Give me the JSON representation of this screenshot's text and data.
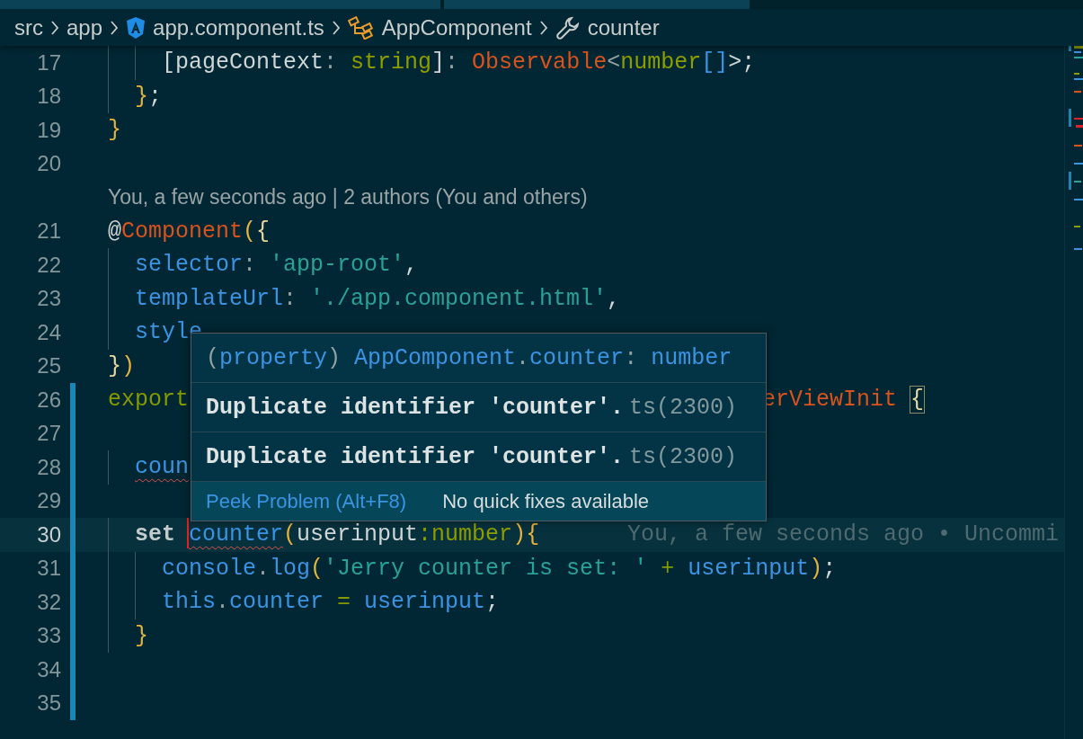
{
  "breadcrumb": [
    {
      "label": "src",
      "kind": "folder"
    },
    {
      "label": "app",
      "kind": "folder"
    },
    {
      "label": "app.component.ts",
      "kind": "file"
    },
    {
      "label": "AppComponent",
      "kind": "class"
    },
    {
      "label": "counter",
      "kind": "member"
    }
  ],
  "lines": [
    {
      "number": "17",
      "current": false,
      "modified": false,
      "tokens": [
        {
          "text": "    [pageContext",
          "kind": "plain"
        },
        {
          "text": ":",
          "kind": "punct"
        },
        {
          "text": " string",
          "kind": "type"
        },
        {
          "text": "]",
          "kind": "plain"
        },
        {
          "text": ": ",
          "kind": "punct"
        },
        {
          "text": "Observable",
          "kind": "class"
        },
        {
          "text": "<",
          "kind": "punct"
        },
        {
          "text": "number",
          "kind": "type"
        },
        {
          "text": "[]",
          "kind": "property"
        },
        {
          "text": ">;",
          "kind": "plain"
        }
      ]
    },
    {
      "number": "18",
      "current": false,
      "modified": false,
      "tokens": [
        {
          "text": "  }",
          "kind": "bracket"
        },
        {
          "text": ";",
          "kind": "plain"
        }
      ]
    },
    {
      "number": "19",
      "current": false,
      "modified": false,
      "tokens": [
        {
          "text": "}",
          "kind": "bracket"
        }
      ]
    },
    {
      "number": "20",
      "current": false,
      "modified": false
    },
    {
      "codelens": "You, a few seconds ago | 2 authors (You and others)"
    },
    {
      "number": "21",
      "current": false,
      "modified": false,
      "tokens": [
        {
          "text": "@",
          "kind": "plain"
        },
        {
          "text": "Component",
          "kind": "class"
        },
        {
          "text": "(",
          "kind": "bracket"
        },
        {
          "text": "{",
          "kind": "brace"
        }
      ]
    },
    {
      "number": "22",
      "current": false,
      "modified": false,
      "tokens": [
        {
          "text": "  selector",
          "kind": "property"
        },
        {
          "text": ": ",
          "kind": "punct"
        },
        {
          "text": "'app-root'",
          "kind": "string"
        },
        {
          "text": ",",
          "kind": "plain"
        }
      ]
    },
    {
      "number": "23",
      "current": false,
      "modified": false,
      "tokens": [
        {
          "text": "  templateUrl",
          "kind": "property"
        },
        {
          "text": ": ",
          "kind": "punct"
        },
        {
          "text": "'./app.component.html'",
          "kind": "string"
        },
        {
          "text": ",",
          "kind": "plain"
        }
      ]
    },
    {
      "number": "24",
      "current": false,
      "modified": false,
      "tokens": [
        {
          "text": "  style",
          "kind": "property"
        }
      ]
    },
    {
      "number": "25",
      "current": false,
      "modified": false,
      "tokens": [
        {
          "text": "}",
          "kind": "brace"
        },
        {
          "text": ")",
          "kind": "bracket"
        }
      ]
    },
    {
      "number": "26",
      "current": false,
      "modified": true,
      "tokens": [
        {
          "text": "export",
          "kind": "keyword"
        }
      ],
      "tail": [
        {
          "text": "erViewInit",
          "kind": "class"
        },
        {
          "text": "{",
          "kind": "match"
        }
      ]
    },
    {
      "number": "27",
      "current": false,
      "modified": true
    },
    {
      "number": "28",
      "current": false,
      "modified": true,
      "tokens": [
        {
          "text": "  coun",
          "kind": "property",
          "error": true
        }
      ]
    },
    {
      "number": "29",
      "current": false,
      "modified": true
    },
    {
      "number": "30",
      "current": true,
      "modified": true,
      "tokens": [
        {
          "text": "  set ",
          "kind": "storage"
        },
        {
          "text": "counter",
          "kind": "property",
          "error": true,
          "caret": true
        },
        {
          "text": "(",
          "kind": "bracket"
        },
        {
          "text": "userinput",
          "kind": "plain"
        },
        {
          "text": ":number",
          "kind": "type"
        },
        {
          "text": ")",
          "kind": "bracket"
        },
        {
          "text": "{",
          "kind": "bracket"
        }
      ],
      "blame": "You, a few seconds ago • Uncommi"
    },
    {
      "number": "31",
      "current": false,
      "modified": true,
      "tokens": [
        {
          "text": "    console",
          "kind": "property"
        },
        {
          "text": ".",
          "kind": "punct"
        },
        {
          "text": "log",
          "kind": "property"
        },
        {
          "text": "(",
          "kind": "bracket"
        },
        {
          "text": "'Jerry counter is set: '",
          "kind": "string"
        },
        {
          "text": " + ",
          "kind": "keyword"
        },
        {
          "text": "userinput",
          "kind": "property"
        },
        {
          "text": ")",
          "kind": "bracket"
        },
        {
          "text": ";",
          "kind": "plain"
        }
      ]
    },
    {
      "number": "32",
      "current": false,
      "modified": true,
      "tokens": [
        {
          "text": "    this",
          "kind": "property"
        },
        {
          "text": ".",
          "kind": "punct"
        },
        {
          "text": "counter",
          "kind": "property"
        },
        {
          "text": " = ",
          "kind": "keyword"
        },
        {
          "text": "userinput",
          "kind": "property"
        },
        {
          "text": ";",
          "kind": "plain"
        }
      ]
    },
    {
      "number": "33",
      "current": false,
      "modified": true,
      "tokens": [
        {
          "text": "  }",
          "kind": "bracket"
        }
      ]
    },
    {
      "number": "34",
      "current": false,
      "modified": true
    },
    {
      "number": "35",
      "current": false,
      "modified": true
    }
  ],
  "hover": {
    "signature": [
      {
        "text": "(",
        "kind": "punct"
      },
      {
        "text": "property",
        "kind": "property"
      },
      {
        "text": ") ",
        "kind": "punct"
      },
      {
        "text": "AppComponent",
        "kind": "property"
      },
      {
        "text": ".",
        "kind": "punct"
      },
      {
        "text": "counter",
        "kind": "property"
      },
      {
        "text": ": ",
        "kind": "punct"
      },
      {
        "text": "number",
        "kind": "property"
      }
    ],
    "problems": [
      {
        "message": "Duplicate identifier 'counter'.",
        "code": "ts(2300)"
      },
      {
        "message": "Duplicate identifier 'counter'.",
        "code": "ts(2300)"
      }
    ],
    "action": "Peek Problem (Alt+F8)",
    "note": "No quick fixes available"
  }
}
